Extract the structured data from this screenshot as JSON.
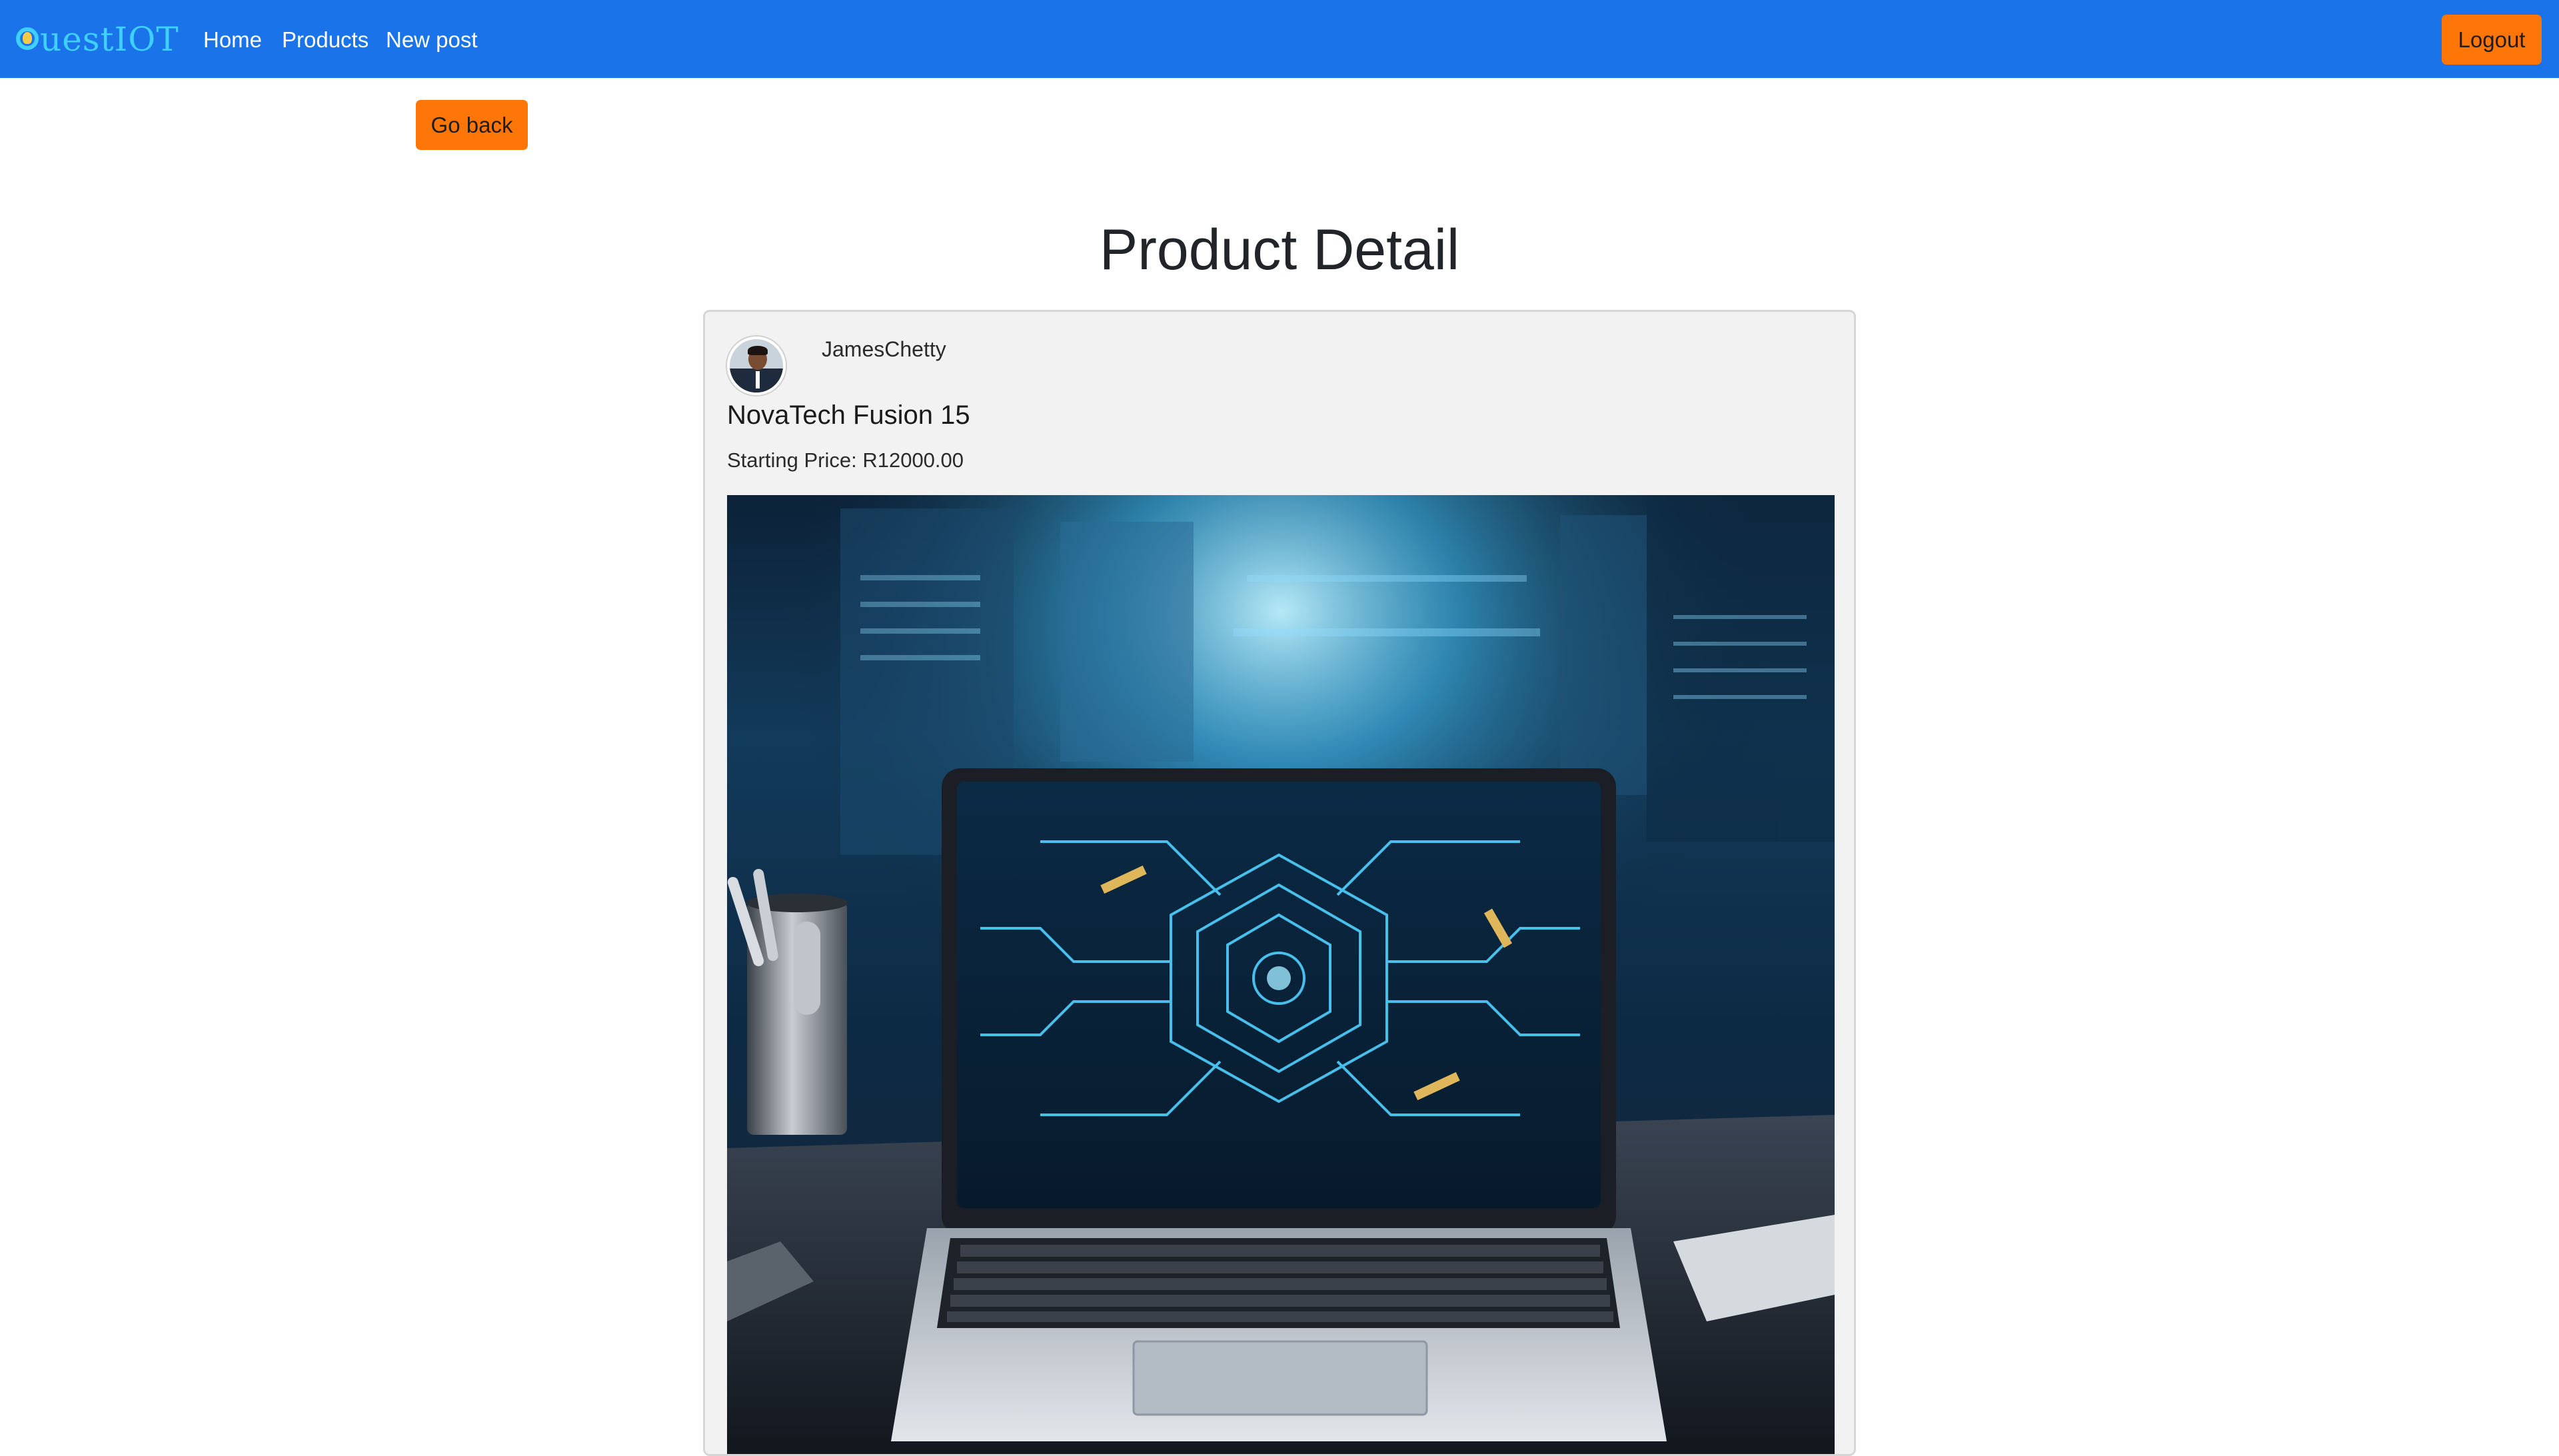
{
  "navbar": {
    "brand": "uestIOT",
    "links": {
      "home": "Home",
      "products": "Products",
      "new_post": "New post"
    },
    "logout_label": "Logout"
  },
  "actions": {
    "go_back_label": "Go back"
  },
  "page": {
    "title": "Product Detail"
  },
  "product": {
    "author": "JamesChetty",
    "name": "NovaTech Fusion 15",
    "price_label": "Starting Price:",
    "price": "R12000.00",
    "image_alt": "NovaTech Fusion 15"
  },
  "colors": {
    "navbar": "#1a73e8",
    "brand": "#3ed0ff",
    "button_accent": "#ff7608",
    "card_background": "#f2f2f2"
  },
  "icons": {
    "brand_logo": "lightbulb-q-icon",
    "avatar": "user-avatar"
  }
}
